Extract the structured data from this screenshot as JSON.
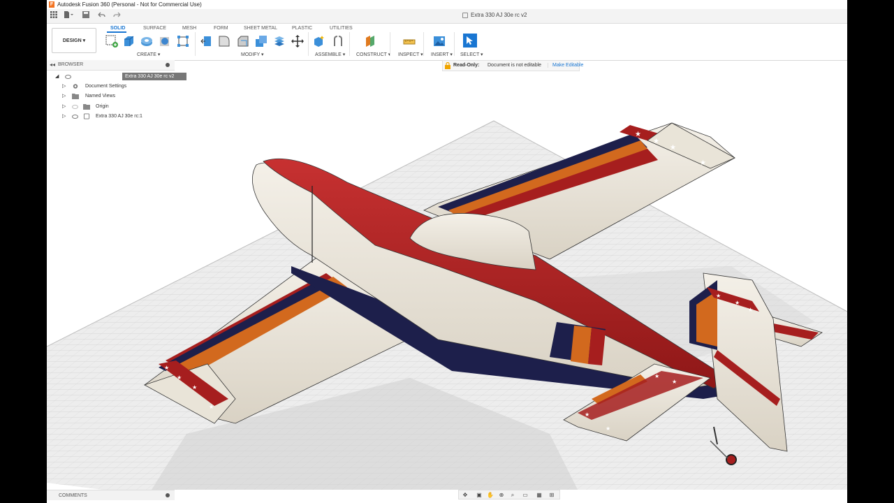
{
  "window": {
    "title": "Autodesk Fusion 360 (Personal - Not for Commercial Use)"
  },
  "document": {
    "tab_title": "Extra 330 AJ 30e rc v2"
  },
  "workspace": {
    "label": "DESIGN"
  },
  "ribbon": {
    "tabs": [
      "SOLID",
      "SURFACE",
      "MESH",
      "FORM",
      "SHEET METAL",
      "PLASTIC",
      "UTILITIES"
    ],
    "active_tab": "SOLID",
    "groups": [
      "CREATE",
      "MODIFY",
      "ASSEMBLE",
      "CONSTRUCT",
      "INSPECT",
      "INSERT",
      "SELECT"
    ]
  },
  "browser": {
    "header": "BROWSER",
    "root": "Extra 330 AJ 30e rc v2",
    "items": [
      "Document Settings",
      "Named Views",
      "Origin",
      "Extra 330 AJ 30e rc:1"
    ]
  },
  "banner": {
    "label": "Read-Only:",
    "message": "Document is not editable",
    "action": "Make Editable"
  },
  "comments": {
    "header": "COMMENTS"
  },
  "colors": {
    "accent": "#1976d2",
    "plane_red": "#a61e1e",
    "plane_cream": "#ece7dc",
    "stripe_orange": "#d2691e",
    "stripe_navy": "#1d1f4b"
  },
  "icons": [
    "grid-icon",
    "file-icon",
    "save-icon",
    "undo-icon",
    "redo-icon",
    "lock-icon",
    "eye-icon",
    "gear-icon",
    "folder-icon",
    "component-icon"
  ]
}
